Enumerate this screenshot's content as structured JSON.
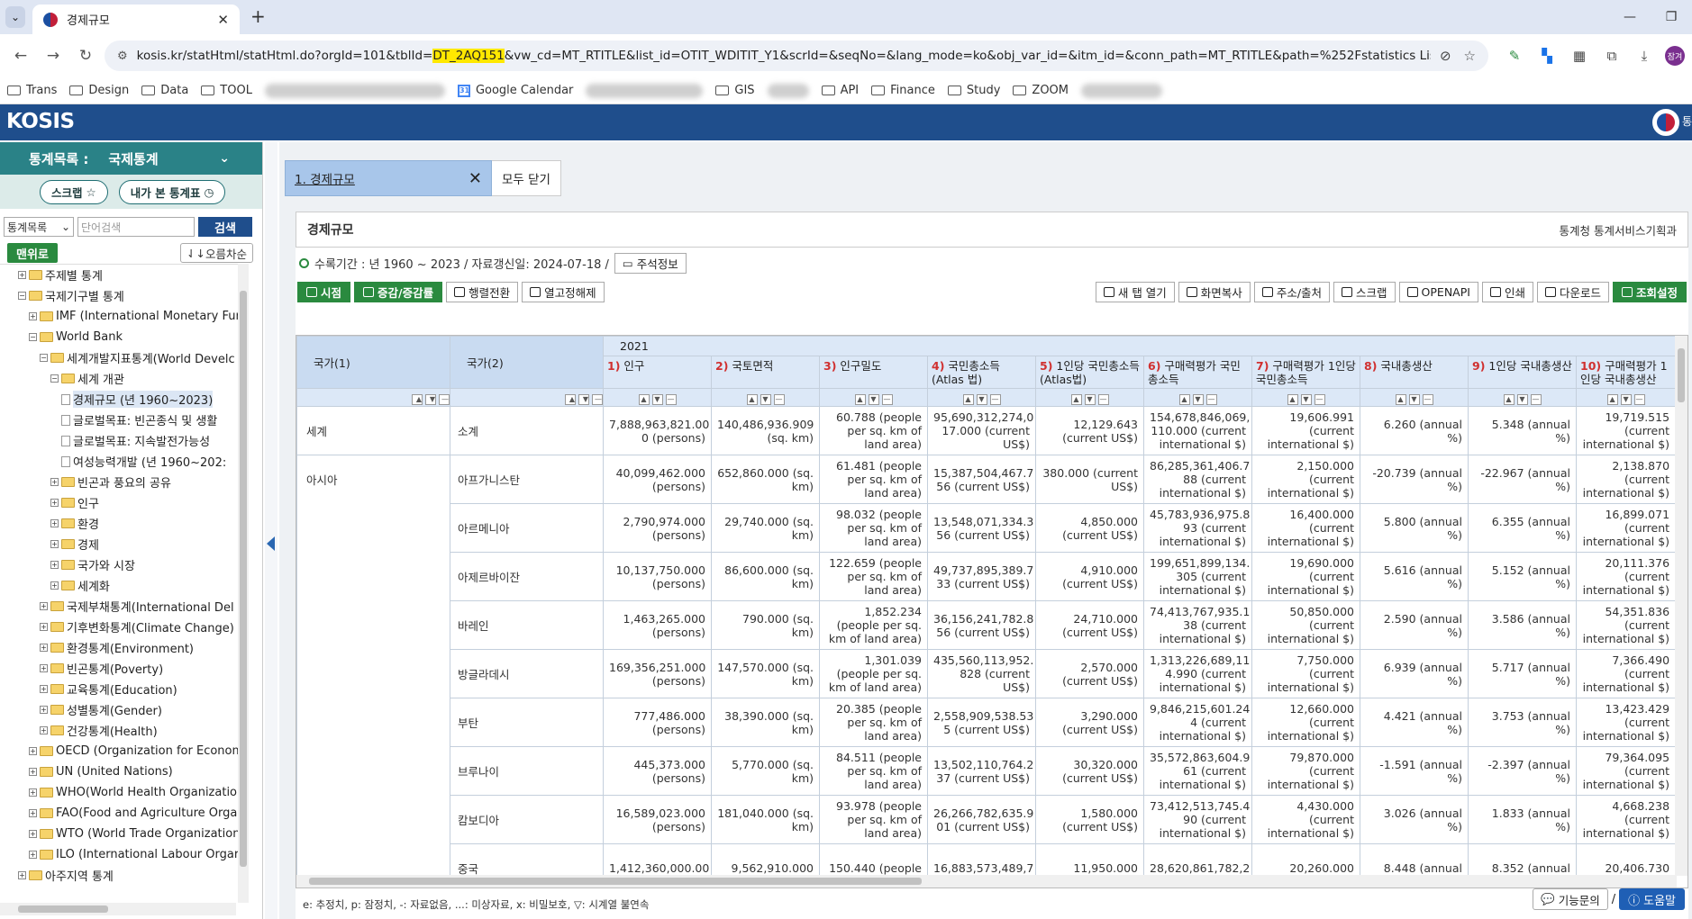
{
  "browser": {
    "tab_title": "경제규모",
    "url_pre": "kosis.kr/statHtml/statHtml.do?orgId=101&tblId=",
    "url_hl": "DT_2AQ151",
    "url_post": "&vw_cd=MT_RTITLE&list_id=OTIT_WDITIT_Y1&scrId=&seqNo=&lang_mode=ko&obj_var_id=&itm_id=&conn_path=MT_RTITLE&path=%252Fstatistics List%252Fs...",
    "avatar": "잠겨",
    "bookmarks": [
      "Trans",
      "Design",
      "Data",
      "TOOL",
      "Google Calendar",
      "GIS",
      "API",
      "Finance",
      "Study",
      "ZOOM"
    ]
  },
  "site": {
    "logo": "KOSIS",
    "emblem_text": "통"
  },
  "sidebar": {
    "label": "통계목록 :",
    "category": "국제통계",
    "scrap": "스크랩",
    "my_tables": "내가 본 통계표",
    "search_select": "통계목록",
    "search_placeholder": "단어검색",
    "search_btn": "검색",
    "to_top": "맨위로",
    "sort": "오름차순",
    "tree": [
      {
        "d": 0,
        "icon": "folder",
        "t": "주제별 통계"
      },
      {
        "d": 0,
        "icon": "folder",
        "t": "국제기구별 통계",
        "open": true
      },
      {
        "d": 1,
        "icon": "folder",
        "t": "IMF (International Monetary Fur"
      },
      {
        "d": 1,
        "icon": "folder",
        "t": "World Bank",
        "open": true
      },
      {
        "d": 2,
        "icon": "folder",
        "t": "세계개발지표통계(World Develc",
        "open": true
      },
      {
        "d": 3,
        "icon": "folder",
        "t": "세계 개관",
        "open": true
      },
      {
        "d": 4,
        "icon": "doc",
        "t": "경제규모 (년 1960~2023)",
        "sel": true
      },
      {
        "d": 4,
        "icon": "doc",
        "t": "글로벌목표: 빈곤종식 및 생활"
      },
      {
        "d": 4,
        "icon": "doc",
        "t": "글로벌목표: 지속발전가능성"
      },
      {
        "d": 4,
        "icon": "doc",
        "t": "여성능력개발 (년 1960~202:"
      },
      {
        "d": 3,
        "icon": "folder",
        "t": "빈곤과 풍요의 공유"
      },
      {
        "d": 3,
        "icon": "folder",
        "t": "인구"
      },
      {
        "d": 3,
        "icon": "folder",
        "t": "환경"
      },
      {
        "d": 3,
        "icon": "folder",
        "t": "경제"
      },
      {
        "d": 3,
        "icon": "folder",
        "t": "국가와 시장"
      },
      {
        "d": 3,
        "icon": "folder",
        "t": "세계화"
      },
      {
        "d": 2,
        "icon": "folder",
        "t": "국제부채통계(International Del"
      },
      {
        "d": 2,
        "icon": "folder",
        "t": "기후변화통계(Climate Change)"
      },
      {
        "d": 2,
        "icon": "folder",
        "t": "환경통계(Environment)"
      },
      {
        "d": 2,
        "icon": "folder",
        "t": "빈곤통계(Poverty)"
      },
      {
        "d": 2,
        "icon": "folder",
        "t": "교육통계(Education)"
      },
      {
        "d": 2,
        "icon": "folder",
        "t": "성별통계(Gender)"
      },
      {
        "d": 2,
        "icon": "folder",
        "t": "건강통계(Health)"
      },
      {
        "d": 1,
        "icon": "folder",
        "t": "OECD (Organization for Econom"
      },
      {
        "d": 1,
        "icon": "folder",
        "t": "UN (United Nations)"
      },
      {
        "d": 1,
        "icon": "folder",
        "t": "WHO(World Health Organizatior"
      },
      {
        "d": 1,
        "icon": "folder",
        "t": "FAO(Food and Agriculture Orgar"
      },
      {
        "d": 1,
        "icon": "folder",
        "t": "WTO (World Trade Organization"
      },
      {
        "d": 1,
        "icon": "folder",
        "t": "ILO (International Labour Orgar"
      },
      {
        "d": 0,
        "icon": "folder",
        "t": "아주지역 통계"
      }
    ]
  },
  "main": {
    "tab_label": "1. 경제규모",
    "close_all": "모두 닫기",
    "panel_title": "경제규모",
    "org": "통계청 통계서비스기획과",
    "meta": "수록기간 : 년 1960 ~ 2023 / 자료갱신일: 2024-07-18 /",
    "meta_btn": "주석정보",
    "left_btns": [
      {
        "t": "시점",
        "style": "green"
      },
      {
        "t": "증감/증감률",
        "style": "green"
      },
      {
        "t": "행렬전환",
        "style": "white"
      },
      {
        "t": "열고정해제",
        "style": "white"
      }
    ],
    "right_btns": [
      {
        "t": "새 탭 열기",
        "style": "white"
      },
      {
        "t": "화면복사",
        "style": "white"
      },
      {
        "t": "주소/출처",
        "style": "white"
      },
      {
        "t": "스크랩",
        "style": "white"
      },
      {
        "t": "OPENAPI",
        "style": "white"
      },
      {
        "t": "인쇄",
        "style": "white"
      },
      {
        "t": "다운로드",
        "style": "white"
      },
      {
        "t": "조회설정",
        "style": "green"
      }
    ],
    "legend": "e: 추정치, p: 잠정치, -: 자료없음, ...: 미상자료, x: 비밀보호, ▽: 시계열 불연속",
    "foot1": "기능문의",
    "foot2": "도움말"
  },
  "grid": {
    "head1": "국가(1)",
    "head2": "국가(2)",
    "year": "2021",
    "columns": [
      {
        "n": "1)",
        "t": "인구"
      },
      {
        "n": "2)",
        "t": "국토면적"
      },
      {
        "n": "3)",
        "t": "인구밀도"
      },
      {
        "n": "4)",
        "t": "국민총소득(Atlas 법)"
      },
      {
        "n": "5)",
        "t": "1인당 국민총소득 (Atlas법)"
      },
      {
        "n": "6)",
        "t": "구매력평가 국민 총소득"
      },
      {
        "n": "7)",
        "t": "구매력평가 1인당 국민총소득"
      },
      {
        "n": "8)",
        "t": "국내총생산"
      },
      {
        "n": "9)",
        "t": "1인당 국내총생산"
      },
      {
        "n": "10)",
        "t": "구매력평가 1인당 국내총생산"
      }
    ],
    "rows": [
      {
        "c1": "세계",
        "c2": "소계",
        "v": [
          "7,888,963,821.00 0 (persons)",
          "140,486,936.909 (sq. km)",
          "60.788 (people per sq. km of land area)",
          "95,690,312,274,0 17.000 (current US$)",
          "12,129.643 (current US$)",
          "154,678,846,069, 110.000 (current international $)",
          "19,606.991 (current international $)",
          "6.260 (annual %)",
          "5.348 (annual %)",
          "19,719.515 (current international $)"
        ]
      },
      {
        "c1": "아시아",
        "c2": "아프가니스탄",
        "v": [
          "40,099,462.000 (persons)",
          "652,860.000 (sq. km)",
          "61.481 (people per sq. km of land area)",
          "15,387,504,467.7 56 (current US$)",
          "380.000 (current US$)",
          "86,285,361,406.7 88 (current international $)",
          "2,150.000 (current international $)",
          "-20.739 (annual %)",
          "-22.967 (annual %)",
          "2,138.870 (current international $)"
        ]
      },
      {
        "c1": "",
        "c2": "아르메니아",
        "v": [
          "2,790,974.000 (persons)",
          "29,740.000 (sq. km)",
          "98.032 (people per sq. km of land area)",
          "13,548,071,334.3 56 (current US$)",
          "4,850.000 (current US$)",
          "45,783,936,975.8 93 (current international $)",
          "16,400.000 (current international $)",
          "5.800 (annual %)",
          "6.355 (annual %)",
          "16,899.071 (current international $)"
        ]
      },
      {
        "c1": "",
        "c2": "아제르바이잔",
        "v": [
          "10,137,750.000 (persons)",
          "86,600.000 (sq. km)",
          "122.659 (people per sq. km of land area)",
          "49,737,895,389.7 33 (current US$)",
          "4,910.000 (current US$)",
          "199,651,899,134. 305 (current international $)",
          "19,690.000 (current international $)",
          "5.616 (annual %)",
          "5.152 (annual %)",
          "20,111.376 (current international $)"
        ]
      },
      {
        "c1": "",
        "c2": "바레인",
        "v": [
          "1,463,265.000 (persons)",
          "790.000 (sq. km)",
          "1,852.234 (people per sq. km of land area)",
          "36,156,241,782.8 56 (current US$)",
          "24,710.000 (current US$)",
          "74,413,767,935.1 38 (current international $)",
          "50,850.000 (current international $)",
          "2.590 (annual %)",
          "3.586 (annual %)",
          "54,351.836 (current international $)"
        ]
      },
      {
        "c1": "",
        "c2": "방글라데시",
        "v": [
          "169,356,251.000 (persons)",
          "147,570.000 (sq. km)",
          "1,301.039 (people per sq. km of land area)",
          "435,560,113,952. 828 (current US$)",
          "2,570.000 (current US$)",
          "1,313,226,689,11 4.990 (current international $)",
          "7,750.000 (current international $)",
          "6.939 (annual %)",
          "5.717 (annual %)",
          "7,366.490 (current international $)"
        ]
      },
      {
        "c1": "",
        "c2": "부탄",
        "v": [
          "777,486.000 (persons)",
          "38,390.000 (sq. km)",
          "20.385 (people per sq. km of land area)",
          "2,558,909,538.53 5 (current US$)",
          "3,290.000 (current US$)",
          "9,846,215,601.24 4 (current international $)",
          "12,660.000 (current international $)",
          "4.421 (annual %)",
          "3.753 (annual %)",
          "13,423.429 (current international $)"
        ]
      },
      {
        "c1": "",
        "c2": "브루나이",
        "v": [
          "445,373.000 (persons)",
          "5,770.000 (sq. km)",
          "84.511 (people per sq. km of land area)",
          "13,502,110,764.2 37 (current US$)",
          "30,320.000 (current US$)",
          "35,572,863,604.9 61 (current international $)",
          "79,870.000 (current international $)",
          "-1.591 (annual %)",
          "-2.397 (annual %)",
          "79,364.095 (current international $)"
        ]
      },
      {
        "c1": "",
        "c2": "캄보디아",
        "v": [
          "16,589,023.000 (persons)",
          "181,040.000 (sq. km)",
          "93.978 (people per sq. km of land area)",
          "26,266,782,635.9 01 (current US$)",
          "1,580.000 (current US$)",
          "73,412,513,745.4 90 (current international $)",
          "4,430.000 (current international $)",
          "3.026 (annual %)",
          "1.833 (annual %)",
          "4,668.238 (current international $)"
        ]
      },
      {
        "c1": "",
        "c2": "중국",
        "v": [
          "1,412,360,000.00",
          "9,562,910.000",
          "150.440 (people",
          "16,883,573,489,7",
          "11,950.000",
          "28,620,861,782,2",
          "20,260.000",
          "8.448 (annual",
          "8.352 (annual",
          "20,406.730"
        ]
      }
    ]
  }
}
